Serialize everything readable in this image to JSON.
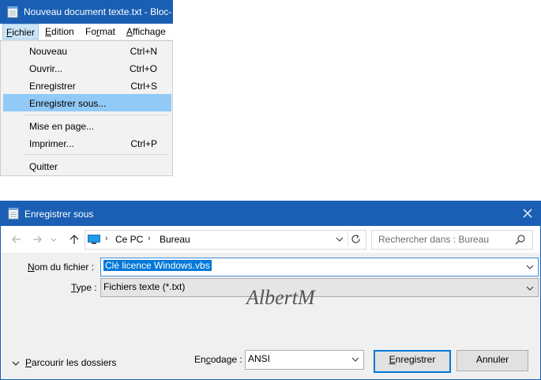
{
  "notepad": {
    "title": "Nouveau document texte.txt - Bloc-",
    "menu": [
      {
        "first": "F",
        "rest": "ichier"
      },
      {
        "first": "E",
        "rest": "dition"
      },
      {
        "first": "Fo",
        "mid": "r",
        "rest": "mat"
      },
      {
        "first": "A",
        "rest": "ffichage"
      }
    ],
    "file_menu": {
      "new": {
        "label": "Nouveau",
        "shortcut": "Ctrl+N"
      },
      "open": {
        "label": "Ouvrir...",
        "shortcut": "Ctrl+O"
      },
      "save": {
        "label": "Enregistrer",
        "shortcut": "Ctrl+S"
      },
      "save_as": {
        "label": "Enregistrer sous..."
      },
      "page_setup": {
        "label": "Mise en page..."
      },
      "print": {
        "label": "Imprimer...",
        "shortcut": "Ctrl+P"
      },
      "quit": {
        "label": "Quitter"
      }
    }
  },
  "dialog": {
    "title": "Enregistrer sous",
    "breadcrumb": [
      "Ce PC",
      "Bureau"
    ],
    "search_placeholder": "Rechercher dans : Bureau",
    "filename_label": {
      "u": "N",
      "rest": "om du fichier :"
    },
    "filename_value": "Clé licence Windows.vbs",
    "type_label": {
      "u": "T",
      "rest": "ype :"
    },
    "type_value": "Fichiers texte (*.txt)",
    "watermark": "AlbertM",
    "browse_label": {
      "u": "P",
      "rest": "arcourir les dossiers"
    },
    "encoding_label": {
      "pre": "En",
      "u": "c",
      "rest": "odage :"
    },
    "encoding_value": "ANSI",
    "save_button": {
      "u": "E",
      "rest": "nregistrer"
    },
    "cancel_button": "Annuler"
  },
  "colors": {
    "title_bar": "#1a5fb4",
    "menu_highlight": "#91c9f7",
    "selection": "#0078d7"
  }
}
